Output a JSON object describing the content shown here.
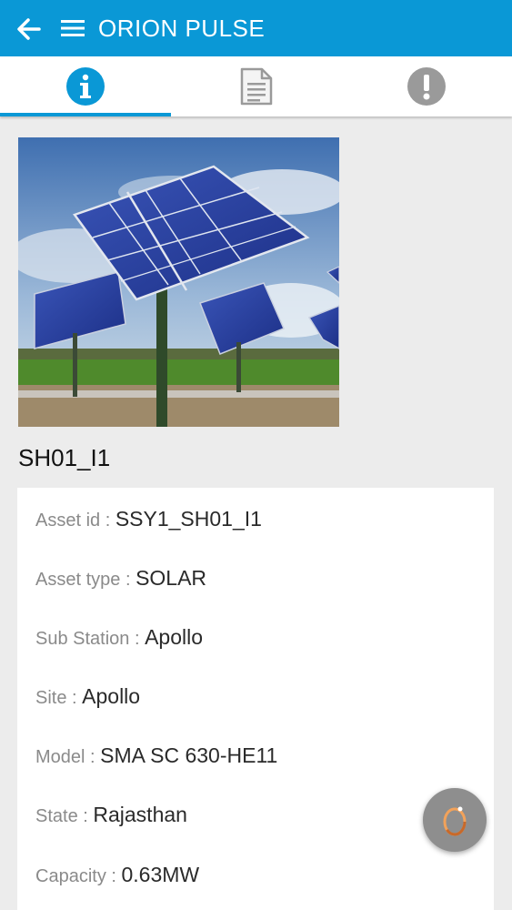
{
  "appbar": {
    "title": "ORION PULSE"
  },
  "tabs": [
    {
      "icon": "info-icon",
      "active": true
    },
    {
      "icon": "document-icon",
      "active": false
    },
    {
      "icon": "alert-icon",
      "active": false
    }
  ],
  "asset": {
    "name": "SH01_I1",
    "fields": [
      {
        "label": "Asset id",
        "value": "SSY1_SH01_I1"
      },
      {
        "label": "Asset type",
        "value": "SOLAR"
      },
      {
        "label": "Sub Station",
        "value": "Apollo"
      },
      {
        "label": "Site",
        "value": "Apollo"
      },
      {
        "label": "Model",
        "value": "SMA SC 630-HE11"
      },
      {
        "label": "State",
        "value": "Rajasthan"
      },
      {
        "label": "Capacity",
        "value": "0.63MW"
      }
    ]
  },
  "colors": {
    "primary": "#0a98d6",
    "fab": "#8e8e8e"
  },
  "fab": {
    "icon": "loading-ring-icon"
  }
}
